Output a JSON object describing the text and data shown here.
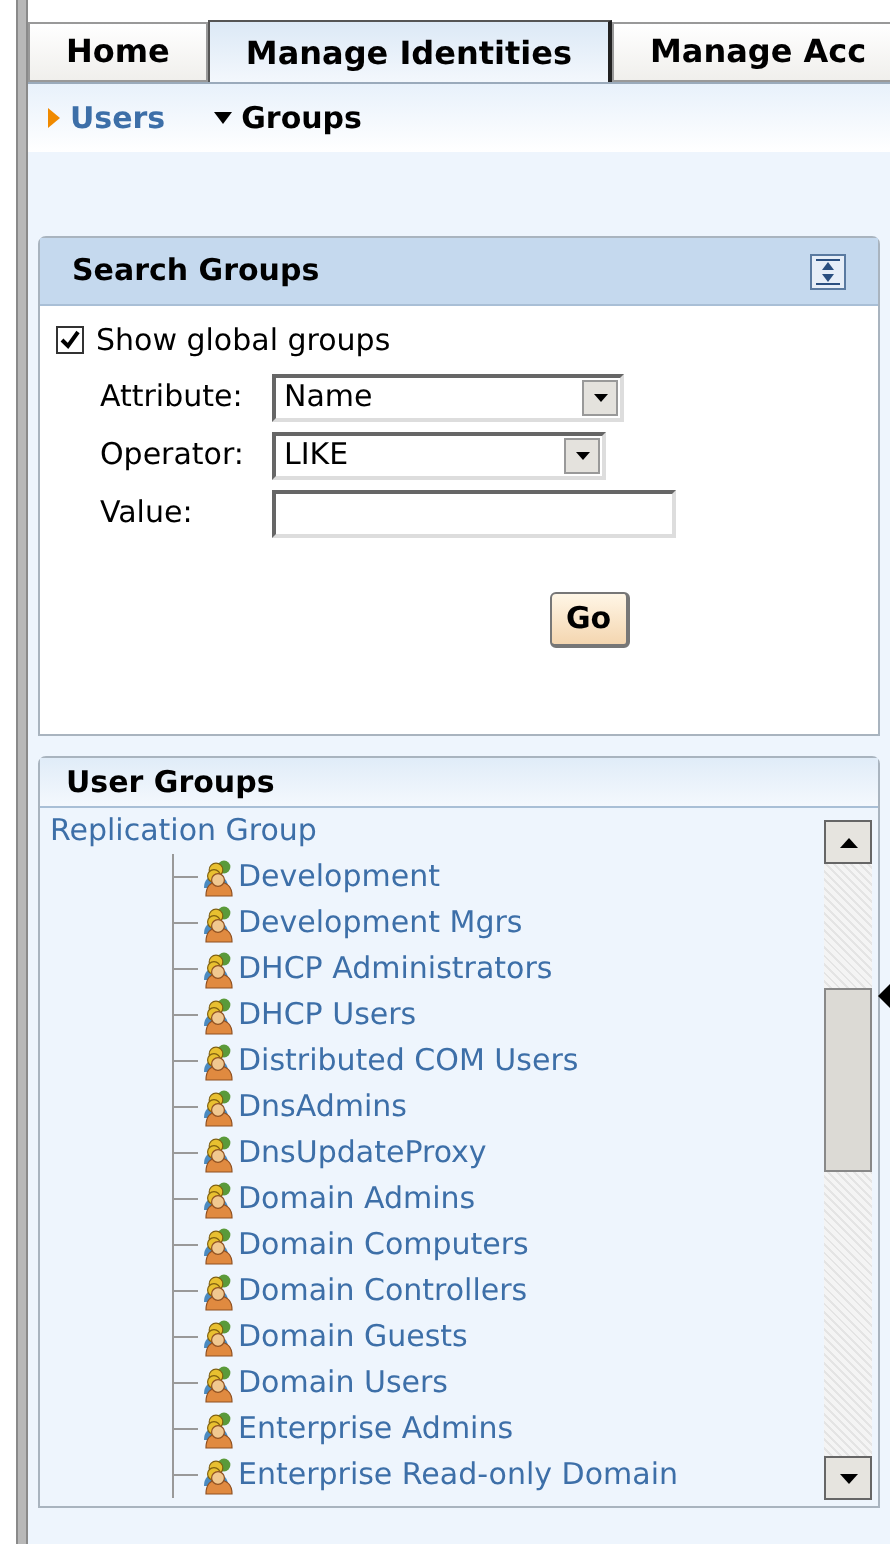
{
  "tabs": [
    {
      "label": "Home",
      "selected": false
    },
    {
      "label": "Manage Identities",
      "selected": true
    },
    {
      "label": "Manage Acc",
      "selected": false
    }
  ],
  "subnav": [
    {
      "label": "Users",
      "expanded": false
    },
    {
      "label": "Groups",
      "expanded": true
    }
  ],
  "search_panel": {
    "title": "Search Groups",
    "show_global": {
      "label": "Show global groups",
      "checked": true
    },
    "fields": [
      {
        "kind": "select",
        "label": "Attribute:",
        "value": "Name"
      },
      {
        "kind": "select",
        "label": "Operator:",
        "value": "LIKE"
      },
      {
        "kind": "text",
        "label": "Value:"
      }
    ],
    "button": "Go"
  },
  "groups_panel": {
    "title": "User Groups",
    "tree": [
      {
        "label": "Replication Group",
        "children": [
          {
            "label": "Development"
          },
          {
            "label": "Development Mgrs"
          },
          {
            "label": "DHCP Administrators"
          },
          {
            "label": "DHCP Users"
          },
          {
            "label": "Distributed COM Users"
          },
          {
            "label": "DnsAdmins"
          },
          {
            "label": "DnsUpdateProxy"
          },
          {
            "label": "Domain Admins"
          },
          {
            "label": "Domain Computers"
          },
          {
            "label": "Domain Controllers"
          },
          {
            "label": "Domain Guests"
          },
          {
            "label": "Domain Users"
          },
          {
            "label": "Enterprise Admins"
          },
          {
            "label": "Enterprise Read-only Domain"
          }
        ]
      }
    ]
  }
}
